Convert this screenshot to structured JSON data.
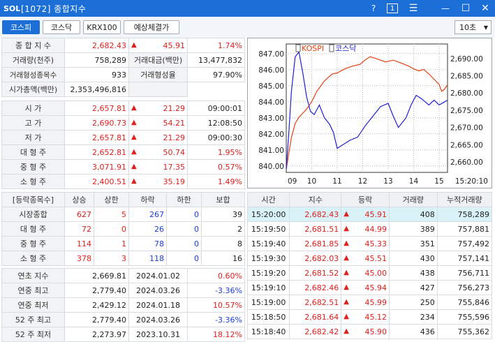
{
  "window": {
    "logo": "SOL",
    "title": "[1072] 종합지수",
    "help": "?",
    "num": "1",
    "menu": "☰",
    "min": "—",
    "max": "☐",
    "close": "✕"
  },
  "tabs": [
    {
      "label": "코스피"
    },
    {
      "label": "코스닥"
    },
    {
      "label": "KRX100"
    },
    {
      "label": "예상체결가"
    }
  ],
  "interval": "10초",
  "summary": {
    "r0": {
      "l": "종 합 지 수",
      "v": "2,682.43",
      "c": "45.91",
      "p": "1.74%"
    },
    "r1": {
      "l1": "거래량(천주)",
      "v1": "758,289",
      "l2": "거래대금(백만)",
      "v2": "13,477,832"
    },
    "r2": {
      "l1": "거래형성종목수",
      "v1": "933",
      "l2": "거래형성율",
      "v2": "97.90%"
    },
    "r3": {
      "l1": "시가총액(백만)",
      "v1": "2,353,496,816"
    }
  },
  "prices": [
    {
      "l": "시    가",
      "v": "2,657.81",
      "c": "21.29",
      "t": "09:00:01"
    },
    {
      "l": "고    가",
      "v": "2,690.73",
      "c": "54.21",
      "t": "12:08:50"
    },
    {
      "l": "저    가",
      "v": "2,657.81",
      "c": "21.29",
      "t": "09:00:30"
    },
    {
      "l": "대 형 주",
      "v": "2,652.81",
      "c": "50.74",
      "t": "1.95%"
    },
    {
      "l": "중 형 주",
      "v": "3,071.91",
      "c": "17.35",
      "t": "0.57%"
    },
    {
      "l": "소 형 주",
      "v": "2,400.51",
      "c": "35.19",
      "t": "1.49%"
    }
  ],
  "breadth": {
    "header": [
      "[등락종목수]",
      "상승",
      "상한",
      "하락",
      "하한",
      "보합"
    ],
    "rows": [
      {
        "l": "시장종합",
        "a": "627",
        "b": "5",
        "c": "267",
        "d": "0",
        "e": "39"
      },
      {
        "l": "대 형 주",
        "a": "72",
        "b": "0",
        "c": "26",
        "d": "0",
        "e": "2"
      },
      {
        "l": "중 형 주",
        "a": "114",
        "b": "1",
        "c": "78",
        "d": "0",
        "e": "8"
      },
      {
        "l": "소 형 주",
        "a": "378",
        "b": "3",
        "c": "118",
        "d": "0",
        "e": "16"
      }
    ]
  },
  "records": [
    {
      "l": "연초 지수",
      "v": "2,669.81",
      "d": "2024.01.02",
      "p": "0.60%",
      "neg": false
    },
    {
      "l": "연중 최고",
      "v": "2,779.40",
      "d": "2024.03.26",
      "p": "-3.36%",
      "neg": true
    },
    {
      "l": "연중 최저",
      "v": "2,429.12",
      "d": "2024.01.18",
      "p": "10.57%",
      "neg": false
    },
    {
      "l": "52 주 최고",
      "v": "2,779.40",
      "d": "2024.03.26",
      "p": "-3.36%",
      "neg": true
    },
    {
      "l": "52 주 최저",
      "v": "2,273.97",
      "d": "2023.10.31",
      "p": "18.12%",
      "neg": false
    }
  ],
  "ticks": {
    "header": [
      "시간",
      "지수",
      "등락",
      "거래량",
      "누적거래량"
    ],
    "rows": [
      {
        "t": "15:20:00",
        "i": "2,682.43",
        "c": "45.91",
        "v": "408",
        "cum": "758,289"
      },
      {
        "t": "15:19:50",
        "i": "2,681.51",
        "c": "44.99",
        "v": "389",
        "cum": "757,881"
      },
      {
        "t": "15:19:40",
        "i": "2,681.85",
        "c": "45.33",
        "v": "351",
        "cum": "757,492"
      },
      {
        "t": "15:19:30",
        "i": "2,682.03",
        "c": "45.51",
        "v": "430",
        "cum": "757,141"
      },
      {
        "t": "15:19:20",
        "i": "2,681.52",
        "c": "45.00",
        "v": "438",
        "cum": "756,711"
      },
      {
        "t": "15:19:10",
        "i": "2,682.46",
        "c": "45.94",
        "v": "427",
        "cum": "756,273"
      },
      {
        "t": "15:19:00",
        "i": "2,682.51",
        "c": "45.99",
        "v": "250",
        "cum": "755,846"
      },
      {
        "t": "15:18:50",
        "i": "2,681.64",
        "c": "45.12",
        "v": "234",
        "cum": "755,596"
      },
      {
        "t": "15:18:40",
        "i": "2,682.42",
        "c": "45.90",
        "v": "436",
        "cum": "755,362"
      }
    ]
  },
  "chart_data": {
    "type": "line",
    "series": [
      {
        "name": "KOSPI",
        "color": "#e8400f",
        "axis": "right",
        "x": [
          9.0,
          9.1,
          9.2,
          9.35,
          9.5,
          9.7,
          9.85,
          10.0,
          10.2,
          10.5,
          10.8,
          11.0,
          11.3,
          11.6,
          11.9,
          12.1,
          12.3,
          12.6,
          12.9,
          13.2,
          13.5,
          13.8,
          14.0,
          14.2,
          14.4,
          14.6,
          14.8,
          15.0,
          15.1,
          15.2,
          15.33
        ],
        "y": [
          2657.8,
          2662.5,
          2667.0,
          2671.2,
          2673.0,
          2674.5,
          2675.8,
          2677.5,
          2680.5,
          2683.5,
          2685.5,
          2685.8,
          2687.0,
          2687.8,
          2688.3,
          2689.6,
          2690.5,
          2689.8,
          2689.0,
          2689.5,
          2688.7,
          2687.8,
          2687.0,
          2686.4,
          2686.8,
          2685.5,
          2684.0,
          2682.5,
          2680.5,
          2681.0,
          2682.4
        ]
      },
      {
        "name": "코스닥",
        "color": "#1f1fd0",
        "axis": "left",
        "x": [
          9.0,
          9.1,
          9.2,
          9.35,
          9.5,
          9.65,
          9.8,
          9.95,
          10.1,
          10.3,
          10.5,
          10.7,
          10.85,
          11.0,
          11.2,
          11.5,
          11.8,
          12.1,
          12.4,
          12.7,
          13.0,
          13.2,
          13.4,
          13.7,
          13.9,
          14.1,
          14.3,
          14.6,
          14.8,
          15.0,
          15.33
        ],
        "y": [
          839.8,
          842.0,
          844.6,
          846.8,
          847.1,
          845.8,
          844.3,
          843.4,
          843.2,
          843.8,
          843.0,
          842.6,
          842.1,
          841.1,
          841.3,
          841.6,
          841.8,
          842.5,
          843.1,
          843.7,
          843.9,
          843.1,
          842.4,
          843.0,
          843.8,
          844.4,
          844.2,
          843.8,
          844.1,
          843.8,
          844.1
        ]
      }
    ],
    "y_left": {
      "ticks": [
        "847.00",
        "846.00",
        "845.00",
        "844.00",
        "843.00",
        "842.00",
        "841.00",
        "840.00"
      ],
      "range": [
        839.6,
        847.6
      ]
    },
    "y_right": {
      "ticks": [
        "2,690.00",
        "2,685.00",
        "2,680.00",
        "2,675.00",
        "2,670.00",
        "2,665.00",
        "2,660.00"
      ],
      "range": [
        2657.0,
        2694.2
      ]
    },
    "x_ticks": [
      "09",
      "10",
      "11",
      "12",
      "13",
      "14",
      "15",
      "15:20:10"
    ],
    "x_range": [
      9.0,
      15.33
    ],
    "grid": true,
    "legend": "top-left"
  }
}
